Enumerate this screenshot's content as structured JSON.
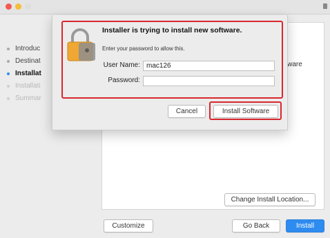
{
  "installer": {
    "steps": [
      {
        "label": "Introduc",
        "state": "done"
      },
      {
        "label": "Destinat",
        "state": "done"
      },
      {
        "label": "Installat",
        "state": "active"
      },
      {
        "label": "Installati",
        "state": "todo"
      },
      {
        "label": "Summar",
        "state": "todo"
      }
    ],
    "panel_text_fragment": "oftware",
    "change_location_label": "Change Install Location...",
    "customize_label": "Customize",
    "go_back_label": "Go Back",
    "install_label": "Install"
  },
  "auth_dialog": {
    "title": "Installer is trying to install new software.",
    "subtitle": "Enter your password to allow this.",
    "username_label": "User Name:",
    "username_value": "mac126",
    "password_label": "Password:",
    "password_value": "",
    "cancel_label": "Cancel",
    "install_software_label": "Install Software"
  },
  "colors": {
    "accent": "#2e8cf0",
    "highlight": "#d9262d",
    "lock_body": "#f0a733"
  },
  "icons": {
    "dialog_icon": "padlock-icon",
    "window_lock": "lock-icon"
  }
}
